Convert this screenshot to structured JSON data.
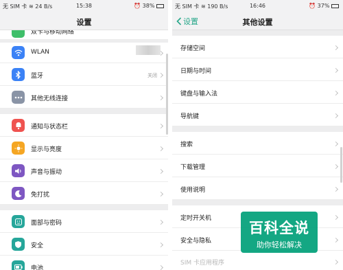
{
  "left_screen": {
    "status": {
      "carrier": "无 SIM 卡",
      "speed": "24 B/s",
      "time": "15:38",
      "battery": "38%"
    },
    "title": "设置",
    "partial_item": "双卡与移动网络",
    "items": [
      {
        "label": "WLAN",
        "value": "",
        "icon": "wifi-icon",
        "color": "#3b82f6"
      },
      {
        "label": "蓝牙",
        "value": "关闭",
        "icon": "bluetooth-icon",
        "color": "#3b82f6"
      },
      {
        "label": "其他无线连接",
        "value": "",
        "icon": "more-dots-icon",
        "color": "#8a94a6"
      },
      {
        "label": "通知与状态栏",
        "value": "",
        "icon": "notification-icon",
        "color": "#ef5350"
      },
      {
        "label": "显示与亮度",
        "value": "",
        "icon": "sun-icon",
        "color": "#f5a623"
      },
      {
        "label": "声音与振动",
        "value": "",
        "icon": "speaker-icon",
        "color": "#7e57c2"
      },
      {
        "label": "免打扰",
        "value": "",
        "icon": "moon-icon",
        "color": "#7e57c2"
      },
      {
        "label": "面部与密码",
        "value": "",
        "icon": "face-icon",
        "color": "#26a69a"
      },
      {
        "label": "安全",
        "value": "",
        "icon": "shield-icon",
        "color": "#26a69a"
      },
      {
        "label": "电池",
        "value": "",
        "icon": "battery-icon",
        "color": "#26a69a"
      }
    ]
  },
  "right_screen": {
    "status": {
      "carrier": "无 SIM 卡",
      "speed": "190 B/s",
      "time": "16:46",
      "battery": "37%"
    },
    "back_label": "设置",
    "title": "其他设置",
    "items": [
      {
        "label": "存储空间"
      },
      {
        "label": "日期与时间"
      },
      {
        "label": "键盘与输入法"
      },
      {
        "label": "导航键"
      },
      {
        "label": "搜索"
      },
      {
        "label": "下载管理"
      },
      {
        "label": "使用说明"
      },
      {
        "label": "定时开关机"
      },
      {
        "label": "安全与隐私"
      },
      {
        "label": "SIM 卡应用程序"
      }
    ]
  },
  "watermark": {
    "title": "百科全说",
    "subtitle": "助你轻松解决"
  }
}
